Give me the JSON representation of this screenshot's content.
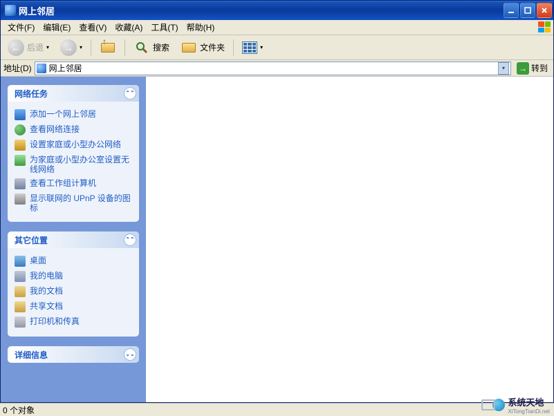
{
  "title": "网上邻居",
  "menu": {
    "file": "文件(F)",
    "edit": "编辑(E)",
    "view": "查看(V)",
    "favorites": "收藏(A)",
    "tools": "工具(T)",
    "help": "帮助(H)"
  },
  "toolbar": {
    "back": "后退",
    "search": "搜索",
    "folders": "文件夹"
  },
  "address": {
    "label": "地址(D)",
    "value": "网上邻居",
    "go": "转到"
  },
  "sidebar": {
    "panels": [
      {
        "title": "网络任务",
        "collapsed": false,
        "items": [
          {
            "label": "添加一个网上邻居",
            "icon": "netadd"
          },
          {
            "label": "查看网络连接",
            "icon": "netconn"
          },
          {
            "label": "设置家庭或小型办公网络",
            "icon": "nethome"
          },
          {
            "label": "为家庭或小型办公室设置无线网络",
            "icon": "wireless"
          },
          {
            "label": "查看工作组计算机",
            "icon": "workgroup"
          },
          {
            "label": "显示联网的 UPnP 设备的图标",
            "icon": "upnp"
          }
        ]
      },
      {
        "title": "其它位置",
        "collapsed": false,
        "items": [
          {
            "label": "桌面",
            "icon": "desktop"
          },
          {
            "label": "我的电脑",
            "icon": "mycomputer"
          },
          {
            "label": "我的文档",
            "icon": "mydocs"
          },
          {
            "label": "共享文档",
            "icon": "shared"
          },
          {
            "label": "打印机和传真",
            "icon": "printer"
          }
        ]
      },
      {
        "title": "详细信息",
        "collapsed": true,
        "items": []
      }
    ]
  },
  "status": "0 个对象",
  "watermark": {
    "main": "系统天地",
    "sub": "XiTongTianDi.net"
  }
}
